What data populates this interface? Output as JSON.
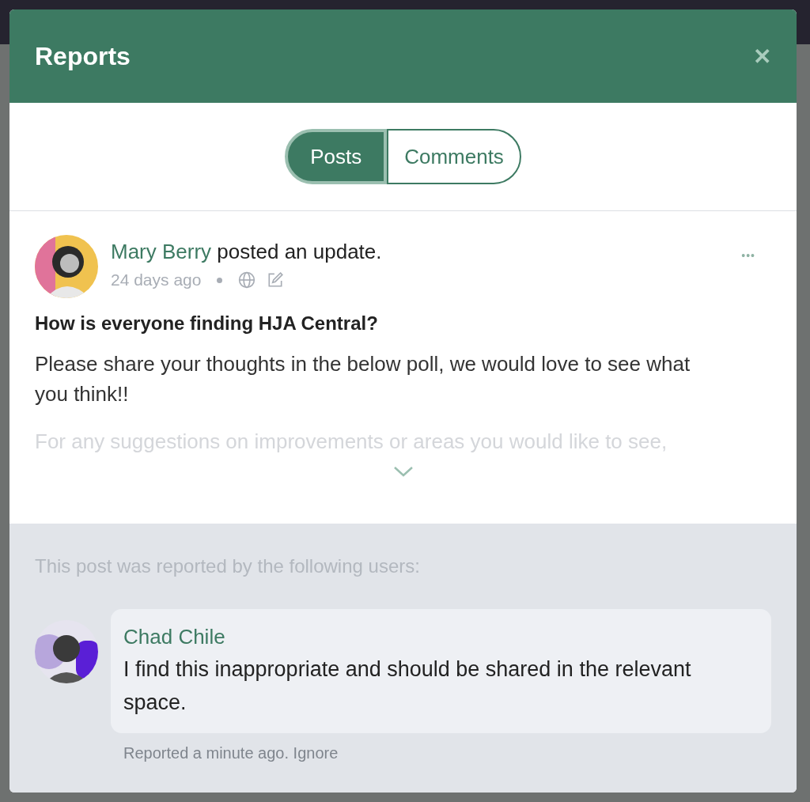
{
  "dialog": {
    "title": "Reports",
    "close": "✕"
  },
  "tabs": [
    {
      "label": "Posts",
      "selected": true
    },
    {
      "label": "Comments",
      "selected": false
    }
  ],
  "post": {
    "author": "Mary Berry",
    "action": "posted an update.",
    "time": "24 days ago",
    "more": "•••",
    "title": "How is everyone finding HJA Central?",
    "paragraphs": [
      {
        "text": "Please share your thoughts in the below poll, we would love to see what you think!!",
        "faded": false
      },
      {
        "text": "For any suggestions on improvements or areas you would like to see,",
        "faded": true
      }
    ]
  },
  "reports": {
    "heading": "This post was reported by the following users:",
    "items": [
      {
        "name": "Chad Chile",
        "text": "I find this inappropriate and should be shared in the relevant space.",
        "meta": "Reported a minute ago.",
        "action": "Ignore"
      }
    ]
  }
}
